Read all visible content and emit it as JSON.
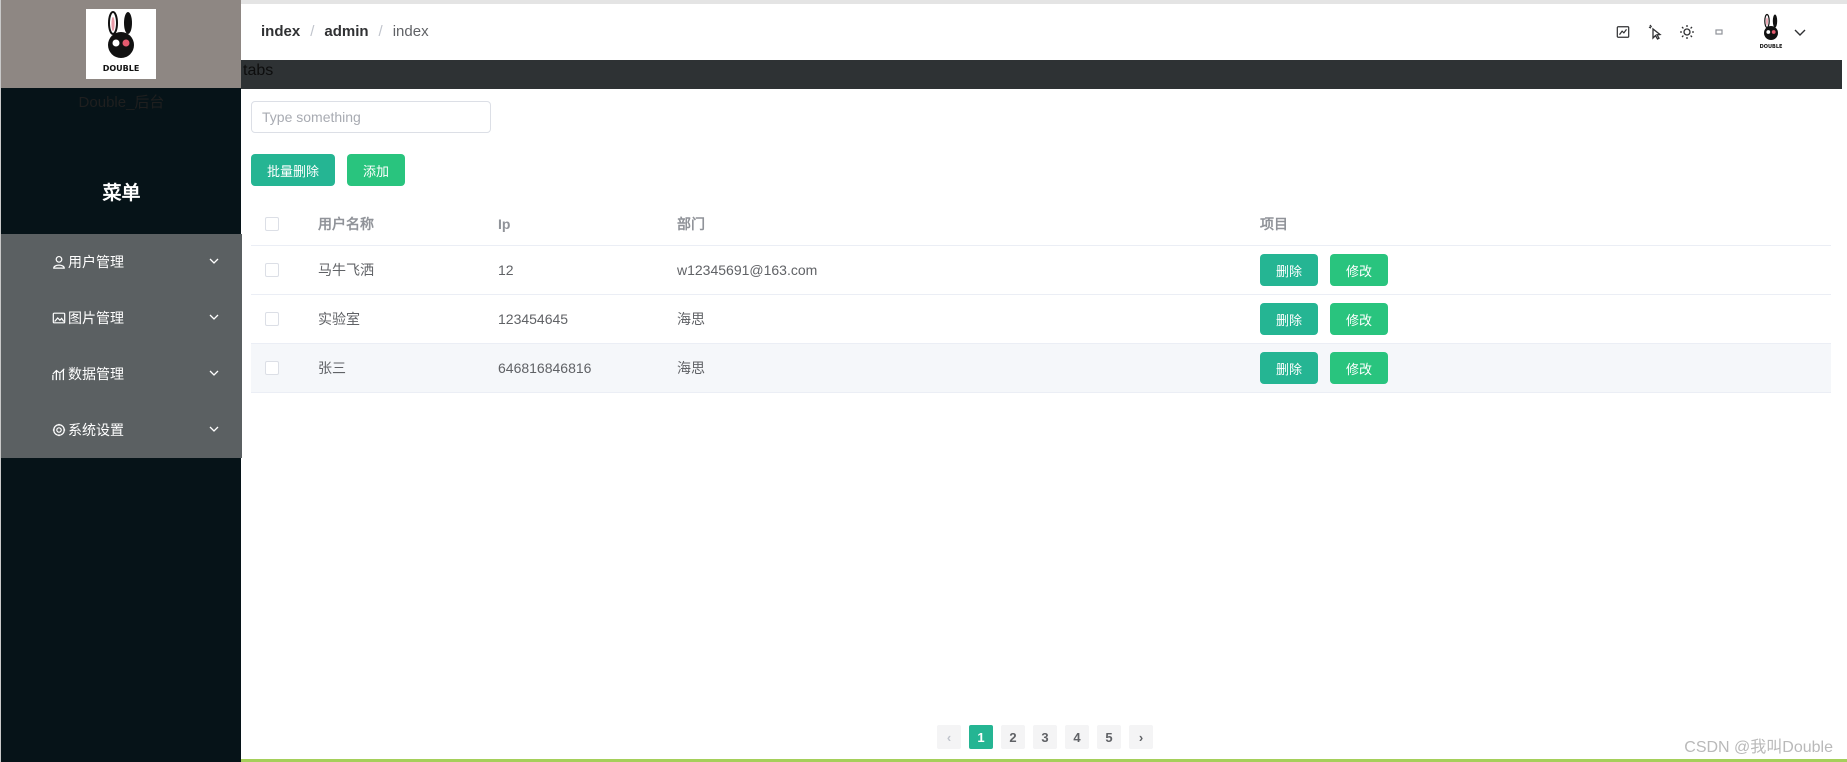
{
  "sidebar": {
    "app_name": "Double_后台",
    "menu_title": "菜单",
    "items": [
      {
        "label": "用户管理",
        "icon": "user-icon"
      },
      {
        "label": "图片管理",
        "icon": "picture-icon"
      },
      {
        "label": "数据管理",
        "icon": "data-chart-icon"
      },
      {
        "label": "系统设置",
        "icon": "settings-icon"
      }
    ]
  },
  "header": {
    "breadcrumb": [
      "index",
      "admin",
      "index"
    ],
    "separator": "/",
    "tools": [
      "chart-icon",
      "pointer-icon",
      "sun-icon",
      "fullscreen-icon"
    ]
  },
  "tabs": {
    "label": "tabs"
  },
  "search": {
    "placeholder": "Type something",
    "value": ""
  },
  "toolbar": {
    "batch_delete_label": "批量删除",
    "add_label": "添加"
  },
  "table": {
    "columns": [
      "用户名称",
      "Ip",
      "部门",
      "项目"
    ],
    "rows": [
      {
        "name": "马牛飞洒",
        "ip": "12",
        "dept": "w12345691@163.com"
      },
      {
        "name": "实验室",
        "ip": "123454645",
        "dept": "海思"
      },
      {
        "name": "张三",
        "ip": "646816846816",
        "dept": "海思"
      }
    ],
    "delete_label": "删除",
    "edit_label": "修改"
  },
  "pagination": {
    "pages": [
      "1",
      "2",
      "3",
      "4",
      "5"
    ],
    "current": "1",
    "prev": "‹",
    "next": "›"
  },
  "watermark": "CSDN @我叫Double",
  "colors": {
    "sidebar_bg": "#061318",
    "menu_bg": "#5b6062",
    "primary": "#25b593",
    "success": "#29c47e"
  }
}
